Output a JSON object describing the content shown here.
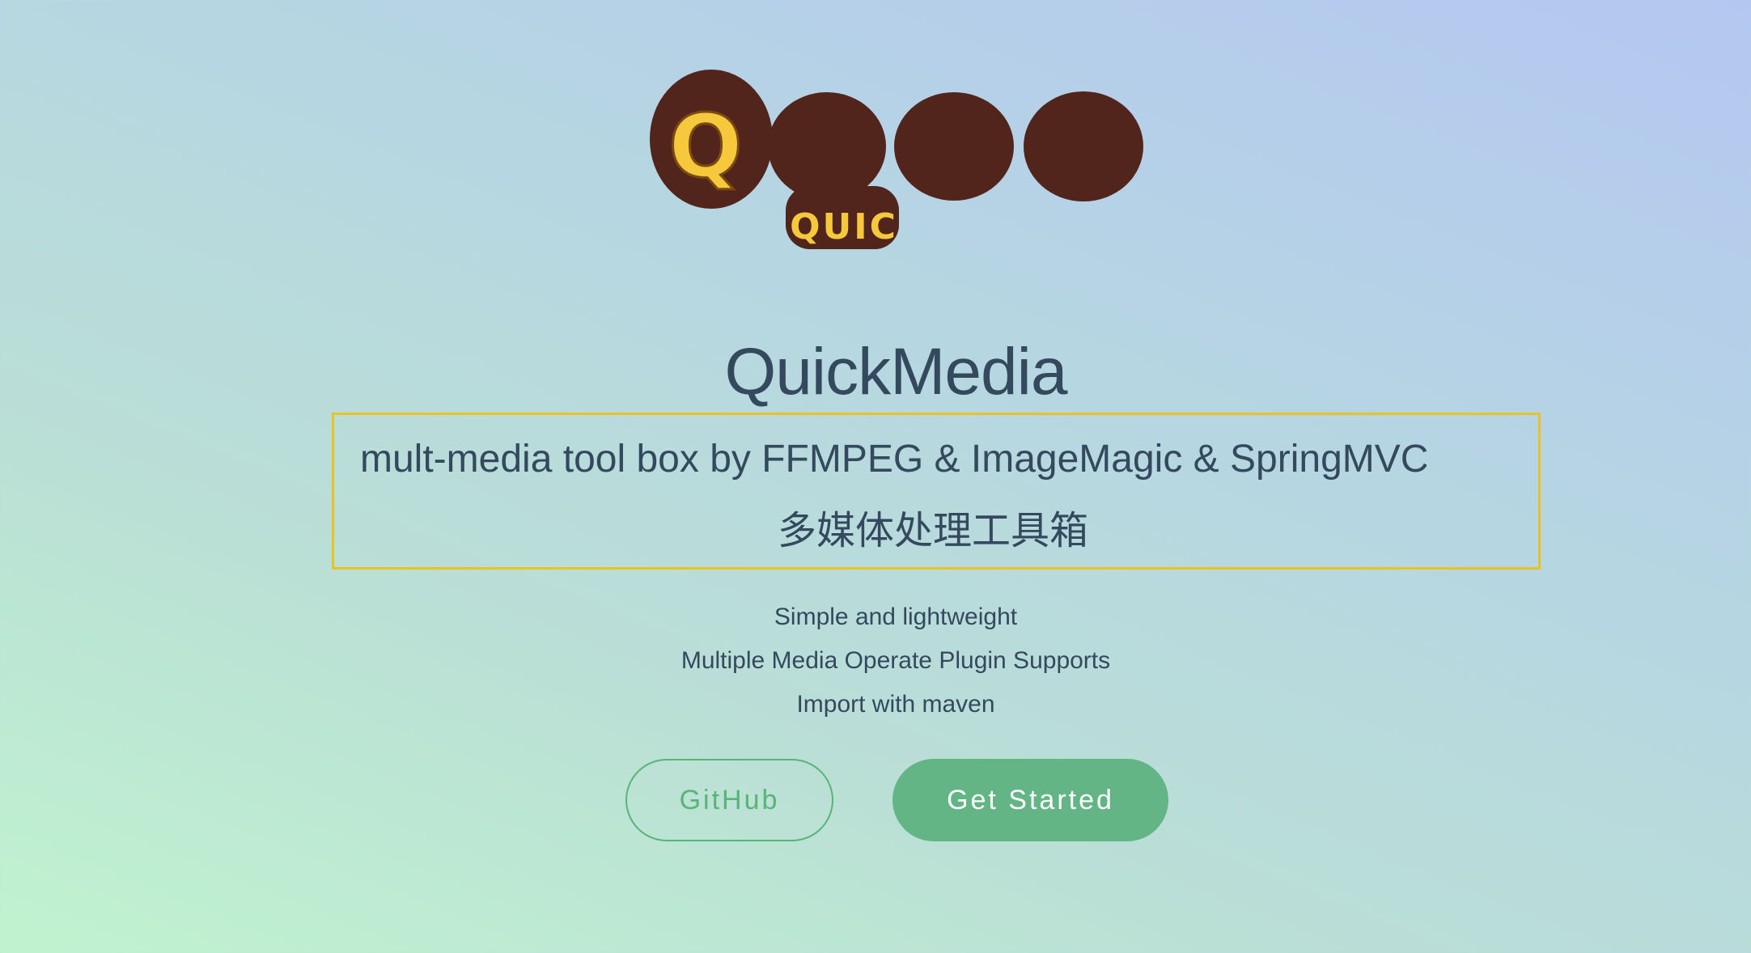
{
  "logo": {
    "letter": "Q",
    "badge_text": "QUIC"
  },
  "hero": {
    "title": "QuickMedia",
    "tagline_en": "mult-media tool box by FFMPEG & ImageMagic & SpringMVC",
    "tagline_zh": "多媒体处理工具箱",
    "features": [
      "Simple and lightweight",
      "Multiple Media Operate Plugin Supports",
      "Import with maven"
    ]
  },
  "buttons": {
    "github_label": "GitHub",
    "get_started_label": "Get Started"
  },
  "colors": {
    "title_text": "#34495e",
    "accent_green": "#63b585",
    "highlight_border": "#e8c321",
    "logo_brown": "#51241c",
    "logo_yellow": "#f6c83b"
  }
}
